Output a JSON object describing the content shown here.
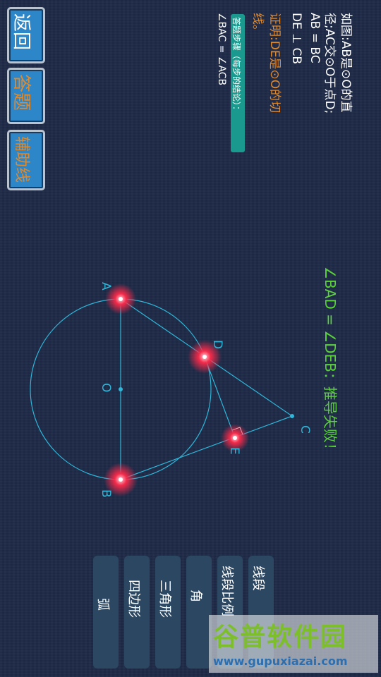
{
  "side_buttons": {
    "back": "返回",
    "answer": "答题",
    "auxiliary": "辅助线"
  },
  "problem": {
    "line1": "如图:AB是⊙O的直",
    "line2": "径;AC交⊙O于点D;",
    "line3": "AB = BC",
    "line4": "DE ⊥ CB",
    "prove1": "证明:DE是⊙O的切",
    "prove2": "线。"
  },
  "steps": {
    "badge": "答题步骤（每步的结论）：",
    "step1": "∠BAC = ∠ACB"
  },
  "feedback": "∠BAD = ∠DEB：推导失败！",
  "figure": {
    "labels": {
      "A": "A",
      "B": "B",
      "C": "C",
      "D": "D",
      "E": "E",
      "O": "O"
    },
    "line_color": "#2fb6d8",
    "highlight_color": "#ff3355"
  },
  "categories": [
    "线段",
    "线段比例",
    "角",
    "三角形",
    "四边形",
    "弧"
  ],
  "watermark": {
    "title": "谷普软件园",
    "url": "www.gupuxiazai.com"
  },
  "colors": {
    "background": "#1e2a47",
    "accent_orange": "#e08a2e",
    "feedback_green": "#5bd23a",
    "badge_teal": "#1a9a8e"
  }
}
